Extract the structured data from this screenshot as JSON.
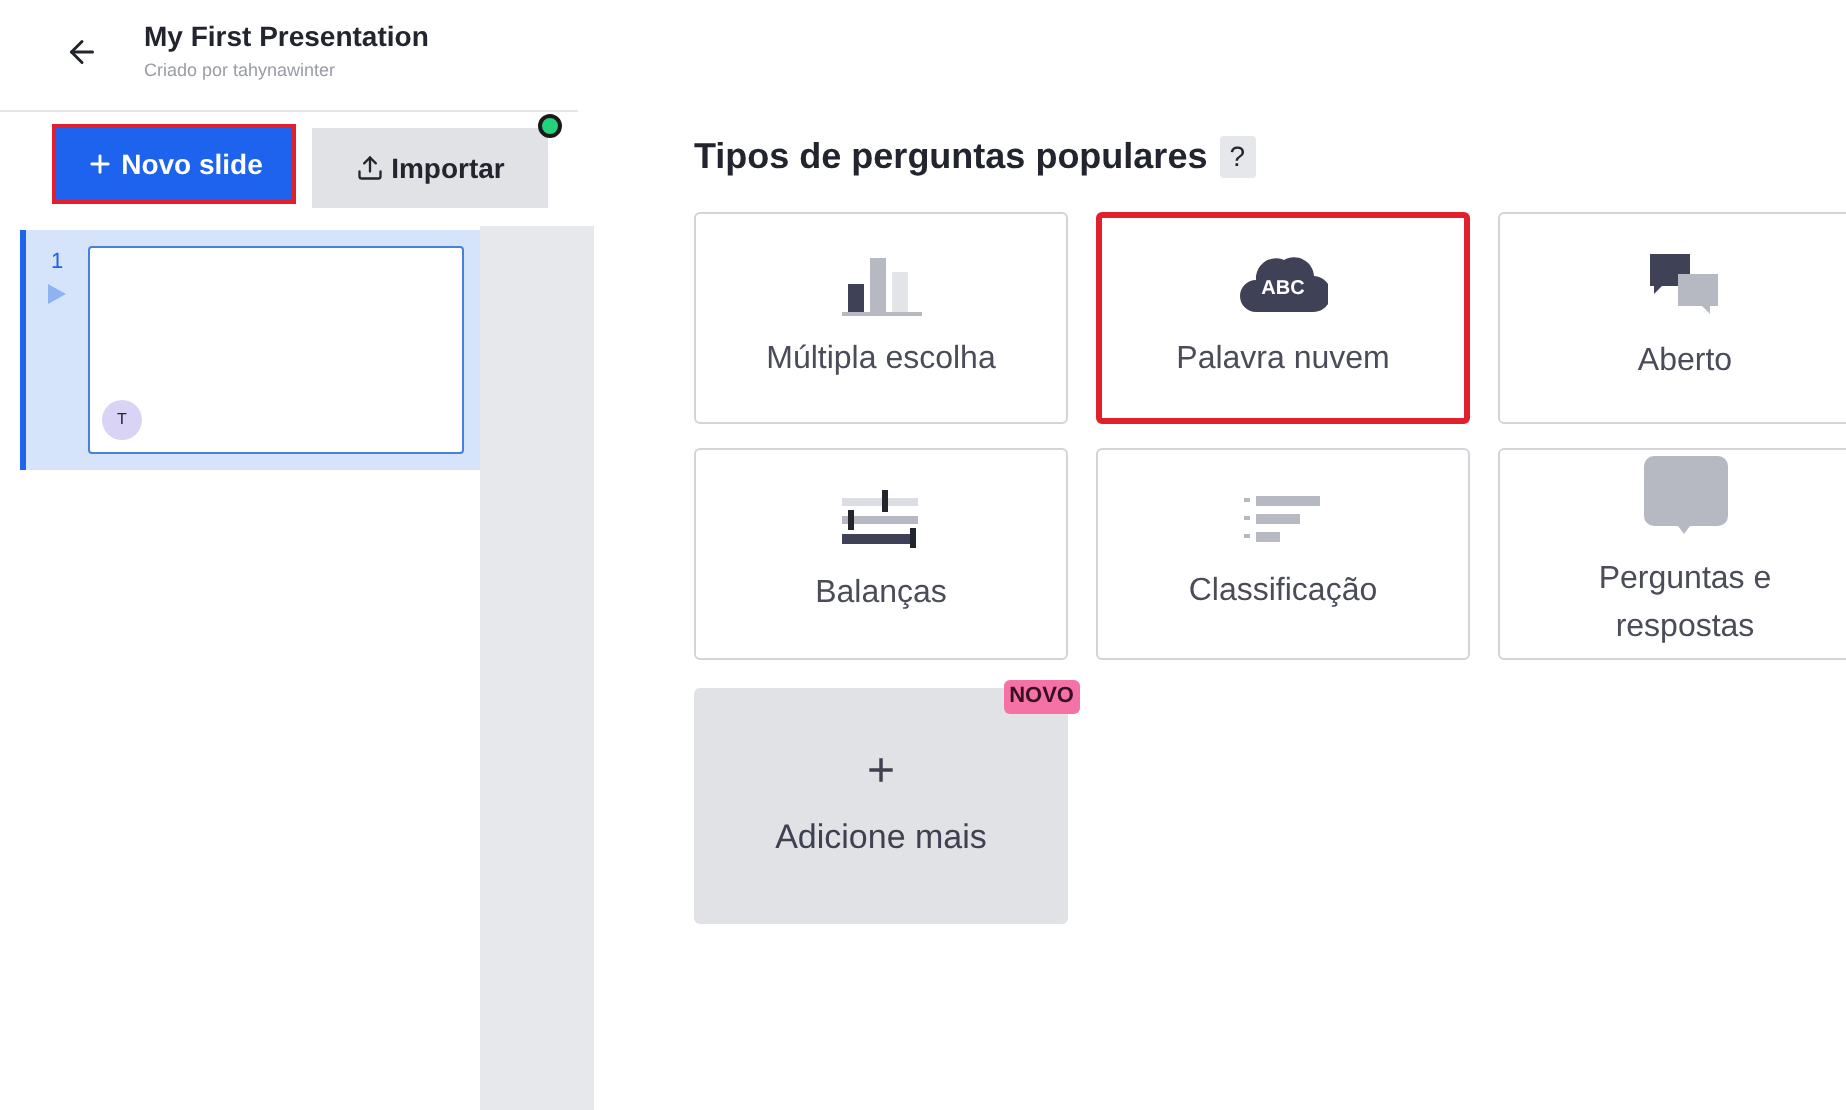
{
  "header": {
    "title": "My First Presentation",
    "subtitle": "Criado por tahynawinter"
  },
  "toolbar": [
    {
      "kind": "new",
      "label": "Novo slide",
      "highlighted": true,
      "badge": false
    },
    {
      "kind": "import",
      "label": "Importar",
      "highlighted": false,
      "badge": true
    }
  ],
  "slides": [
    {
      "number": "1",
      "selected": true,
      "avatar": "T"
    }
  ],
  "section": {
    "title": "Tipos de perguntas populares",
    "help": "?"
  },
  "question_types": [
    {
      "kind": "bars",
      "label": "Múltipla escolha",
      "highlighted": false
    },
    {
      "kind": "cloud",
      "label": "Palavra nuvem",
      "icon_text": "ABC",
      "highlighted": true
    },
    {
      "kind": "chat",
      "label": "Aberto",
      "highlighted": false
    },
    {
      "kind": "scales",
      "label": "Balanças",
      "highlighted": false
    },
    {
      "kind": "ranking",
      "label": "Classificação",
      "highlighted": false
    },
    {
      "kind": "bubble",
      "label": "Perguntas e respostas",
      "highlighted": false
    }
  ],
  "add_more": {
    "symbol": "+",
    "label": "Adicione mais",
    "badge": "NOVO"
  }
}
